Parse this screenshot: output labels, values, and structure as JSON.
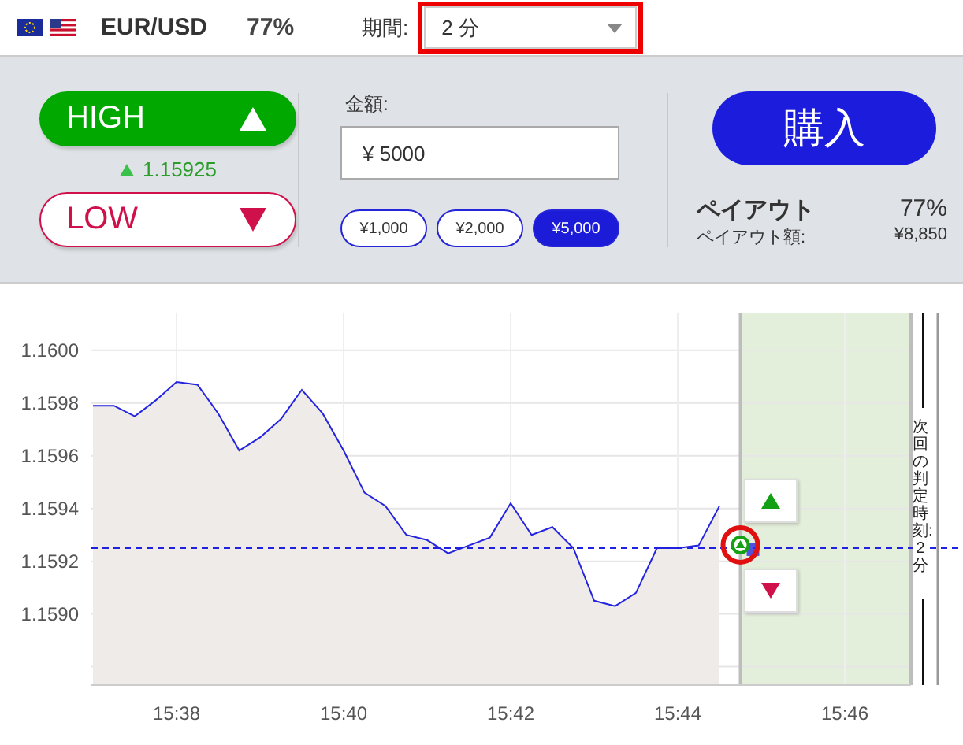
{
  "header": {
    "pair": "EUR/USD",
    "payout": "77%",
    "period": {
      "label": "期間:",
      "value": "2 分",
      "highlighted": true
    }
  },
  "trade": {
    "directions": [
      {
        "kind": "high",
        "label": "HIGH"
      },
      {
        "kind": "low",
        "label": "LOW"
      }
    ],
    "current_price": "1.15925",
    "amount": {
      "label": "金額:",
      "value": "¥ 5000"
    },
    "presets": [
      {
        "label": "¥1,000",
        "selected": false
      },
      {
        "label": "¥2,000",
        "selected": false
      },
      {
        "label": "¥5,000",
        "selected": true
      }
    ],
    "buy_button": "購入",
    "payout": {
      "label": "ペイアウト",
      "value": "77%"
    },
    "payout_amount": {
      "label": "ペイアウト額:",
      "value": "¥8,850"
    }
  },
  "chart": {
    "chart_data": {
      "type": "area",
      "categories": [
        null,
        null,
        null,
        null,
        "15:38",
        null,
        null,
        null,
        null,
        null,
        null,
        null,
        "15:40",
        null,
        null,
        null,
        null,
        null,
        null,
        null,
        "15:42",
        null,
        null,
        null,
        null,
        null,
        null,
        null,
        "15:44",
        null,
        null,
        null,
        null,
        null,
        null,
        null,
        "15:46",
        null,
        null,
        null
      ],
      "series": [
        {
          "color": "#2424e0",
          "values": [
            1.15979,
            1.15979,
            1.15975,
            1.15981,
            1.15988,
            1.15987,
            1.15976,
            1.15962,
            1.15967,
            1.15974,
            1.15985,
            1.15976,
            1.15962,
            1.15946,
            1.15941,
            1.1593,
            1.15928,
            1.15923,
            1.15926,
            1.15929,
            1.15942,
            1.1593,
            1.15933,
            1.15925,
            1.15905,
            1.15903,
            1.15908,
            1.15925,
            1.15925,
            1.15926,
            1.15941,
            null,
            null,
            null,
            null,
            null,
            null,
            null,
            null,
            null
          ]
        }
      ],
      "ylim": [
        1.15873,
        1.16014
      ],
      "grid": true,
      "ref_lines": [
        {
          "axis": "y",
          "value": 1.15925
        }
      ],
      "yticks": [
        {
          "value": 1.159,
          "label": "1.1590"
        },
        {
          "value": 1.1592,
          "label": "1.1592"
        },
        {
          "value": 1.1594,
          "label": "1.1594"
        },
        {
          "value": 1.1596,
          "label": "1.1596"
        },
        {
          "value": 1.1598,
          "label": "1.1598"
        },
        {
          "value": 1.16,
          "label": "1.1600"
        }
      ]
    },
    "quick_buttons": [
      {
        "kind": "high"
      },
      {
        "kind": "low"
      }
    ],
    "deadline_label": "次回の判定時刻: 2 分"
  }
}
